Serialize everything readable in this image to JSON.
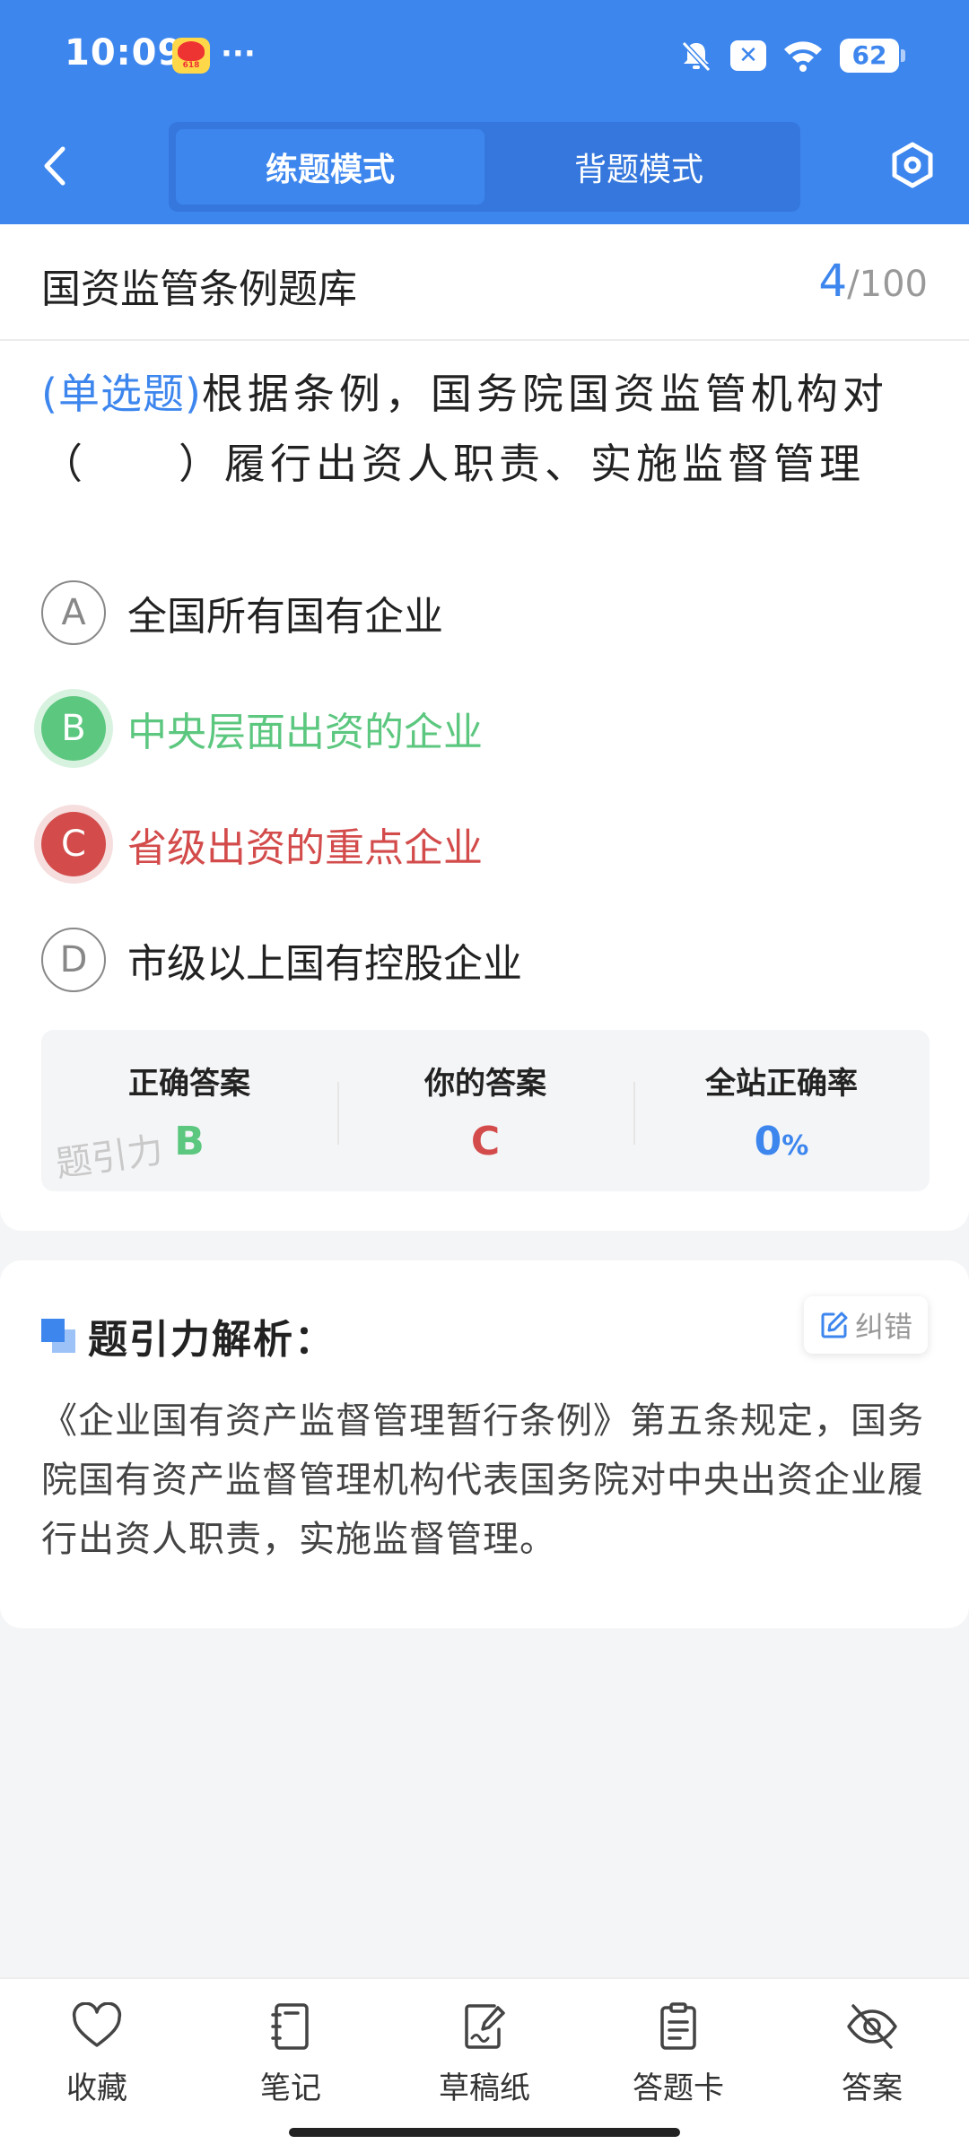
{
  "status_bar": {
    "time": "10:09",
    "dots": "···",
    "battery": "62",
    "x_badge": "✕"
  },
  "header": {
    "tabs": [
      {
        "label": "练题模式",
        "active": true
      },
      {
        "label": "背题模式",
        "active": false
      }
    ]
  },
  "bank": {
    "title": "国资监管条例题库",
    "current": "4",
    "total": "/100"
  },
  "question": {
    "type": "(单选题)",
    "text": "根据条例，国务院国资监管机构对（　　）履行出资人职责、实施监督管理"
  },
  "options": [
    {
      "letter": "A",
      "text": "全国所有国有企业",
      "state": "normal"
    },
    {
      "letter": "B",
      "text": "中央层面出资的企业",
      "state": "correct"
    },
    {
      "letter": "C",
      "text": "省级出资的重点企业",
      "state": "wrong"
    },
    {
      "letter": "D",
      "text": "市级以上国有控股企业",
      "state": "normal"
    }
  ],
  "stats": {
    "correct_label": "正确答案",
    "correct_value": "B",
    "yours_label": "你的答案",
    "yours_value": "C",
    "rate_label": "全站正确率",
    "rate_value": "0",
    "rate_unit": "%",
    "watermark": "题引力"
  },
  "analysis": {
    "title": "题引力解析：",
    "report_label": "纠错",
    "body": "《企业国有资产监督管理暂行条例》第五条规定，国务院国有资产监督管理机构代表国务院对中央出资企业履行出资人职责，实施监督管理。"
  },
  "bottom_nav": {
    "favorite": "收藏",
    "notes": "笔记",
    "draft": "草稿纸",
    "answer_card": "答题卡",
    "answer": "答案"
  },
  "colors": {
    "primary": "#3d86ee",
    "correct": "#5cc77f",
    "wrong": "#d34b4b"
  }
}
